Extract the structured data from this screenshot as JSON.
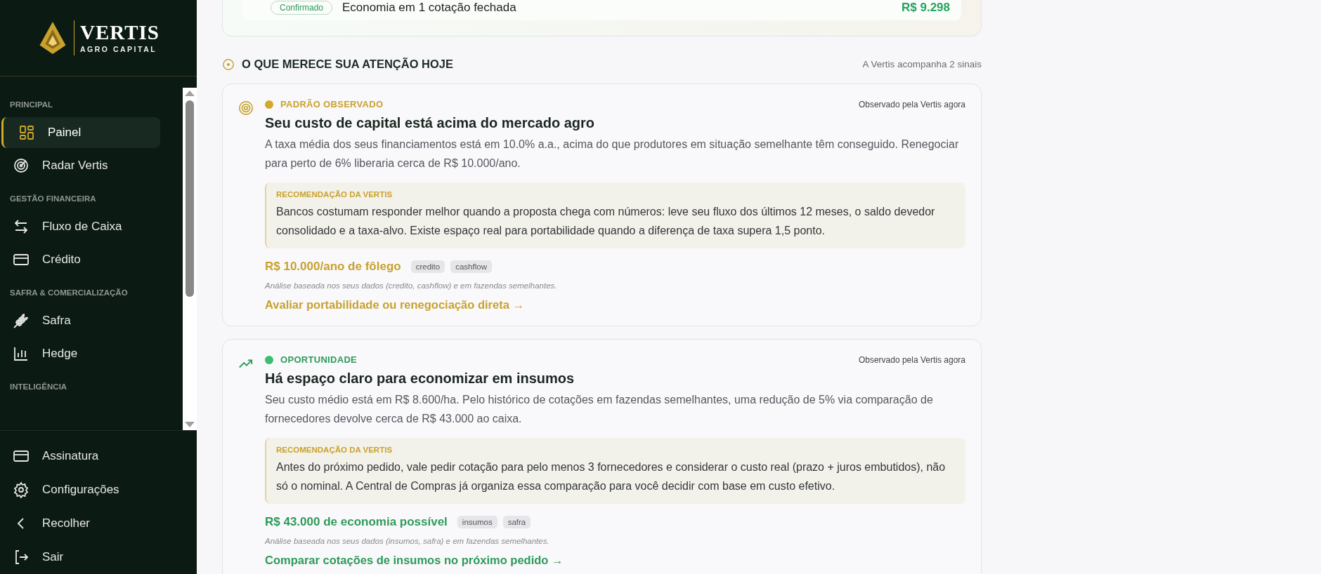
{
  "sidebar": {
    "logo": {
      "name": "VERTIS",
      "tagline": "AGRO CAPITAL"
    },
    "sections": [
      {
        "title": "PRINCIPAL",
        "items": [
          {
            "label": "Painel",
            "selected": true
          },
          {
            "label": "Radar Vertis",
            "selected": false
          }
        ]
      },
      {
        "title": "GESTÃO FINANCEIRA",
        "items": [
          {
            "label": "Fluxo de Caixa",
            "selected": false
          },
          {
            "label": "Crédito",
            "selected": false
          }
        ]
      },
      {
        "title": "SAFRA & COMERCIALIZAÇÃO",
        "items": [
          {
            "label": "Safra",
            "selected": false
          },
          {
            "label": "Hedge",
            "selected": false
          }
        ]
      },
      {
        "title": "INTELIGÊNCIA"
      }
    ],
    "footer_items": [
      {
        "label": "Assinatura"
      },
      {
        "label": "Configurações"
      },
      {
        "label": "Recolher"
      },
      {
        "label": "Sair"
      }
    ]
  },
  "top_card": {
    "row": {
      "status": "Confirmado",
      "description": "Economia em 1 cotação fechada",
      "amount": "R$ 9.298"
    }
  },
  "attention": {
    "title": "O QUE MERECE SUA ATENÇÃO HOJE",
    "note": "A Vertis acompanha 2 sinais",
    "signals": [
      {
        "kind": "pattern",
        "category": "PADRÃO OBSERVADO",
        "color": "#d4a82a",
        "observed": "Observado pela Vertis agora",
        "title": "Seu custo de capital está acima do mercado agro",
        "body": "A taxa média dos seus financiamentos está em 10.0% a.a., acima do que produtores em situação semelhante têm conseguido. Renegociar para perto de 6% liberaria cerca de R$ 10.000/ano.",
        "recommendation": {
          "label": "RECOMENDAÇÃO DA VERTIS",
          "text": "Bancos costumam responder melhor quando a proposta chega com números: leve seu fluxo dos últimos 12 meses, o saldo devedor consolidado e a taxa-alvo. Existe espaço real para portabilidade quando a diferença de taxa supera 1,5 ponto."
        },
        "impact": "R$ 10.000/ano de fôlego",
        "tags": [
          "credito",
          "cashflow"
        ],
        "analysis": "Análise baseada nos seus dados (credito, cashflow) e em fazendas semelhantes.",
        "action": "Avaliar portabilidade ou renegociação direta →"
      },
      {
        "kind": "opportunity",
        "category": "OPORTUNIDADE",
        "color": "#3bbf6f",
        "observed": "Observado pela Vertis agora",
        "title": "Há espaço claro para economizar em insumos",
        "body": "Seu custo médio está em R$ 8.600/ha. Pelo histórico de cotações em fazendas semelhantes, uma redução de 5% via comparação de fornecedores devolve cerca de R$ 43.000 ao caixa.",
        "recommendation": {
          "label": "RECOMENDAÇÃO DA VERTIS",
          "text": "Antes do próximo pedido, vale pedir cotação para pelo menos 3 fornecedores e considerar o custo real (prazo + juros embutidos), não só o nominal. A Central de Compras já organiza essa comparação para você decidir com base em custo efetivo."
        },
        "impact": "R$ 43.000 de economia possível",
        "tags": [
          "insumos",
          "safra"
        ],
        "analysis": "Análise baseada nos seus dados (insumos, safra) e em fazendas semelhantes.",
        "action": "Comparar cotações de insumos no próximo pedido →"
      }
    ]
  }
}
